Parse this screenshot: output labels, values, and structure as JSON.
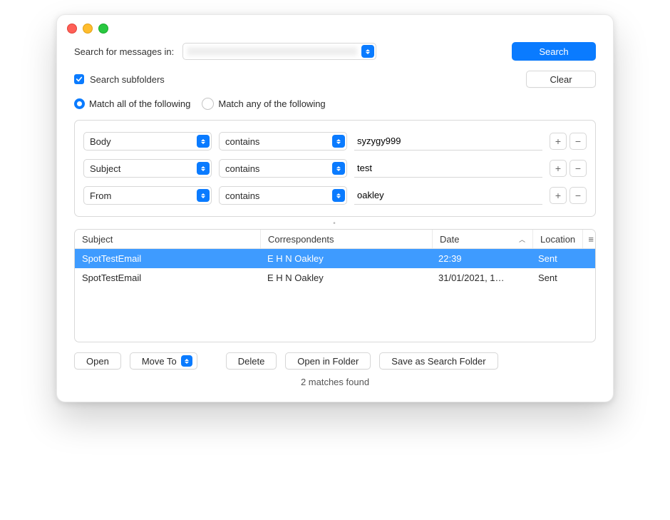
{
  "header": {
    "search_in_label": "Search for messages in:",
    "account_display": "",
    "search_button": "Search",
    "clear_button": "Clear"
  },
  "options": {
    "search_subfolders_label": "Search subfolders",
    "search_subfolders_checked": true,
    "match_mode": "all",
    "match_all_label": "Match all of the following",
    "match_any_label": "Match any of the following"
  },
  "criteria": [
    {
      "field": "Body",
      "op": "contains",
      "value": "syzygy999"
    },
    {
      "field": "Subject",
      "op": "contains",
      "value": "test"
    },
    {
      "field": "From",
      "op": "contains",
      "value": "oakley"
    }
  ],
  "results": {
    "columns": {
      "subject": "Subject",
      "correspondents": "Correspondents",
      "date": "Date",
      "location": "Location"
    },
    "sort_column": "date",
    "sort_dir": "asc",
    "rows": [
      {
        "subject": "SpotTestEmail",
        "correspondents": "E H N Oakley",
        "date": "22:39",
        "location": "Sent",
        "selected": true
      },
      {
        "subject": "SpotTestEmail",
        "correspondents": "E H N Oakley",
        "date": "31/01/2021, 1…",
        "location": "Sent",
        "selected": false
      }
    ]
  },
  "footer": {
    "open": "Open",
    "move_to": "Move To",
    "delete": "Delete",
    "open_in_folder": "Open in Folder",
    "save_as_search_folder": "Save as Search Folder",
    "status": "2 matches found"
  }
}
